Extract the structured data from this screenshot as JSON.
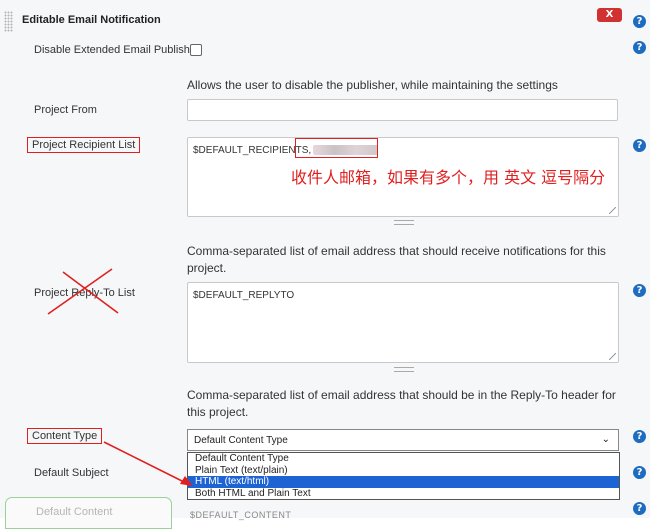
{
  "section": {
    "title": "Editable Email Notification",
    "close_label": "X"
  },
  "fields": {
    "disable_publisher": {
      "label": "Disable Extended Email Publisher",
      "checked": false,
      "description": "Allows the user to disable the publisher, while maintaining the settings"
    },
    "project_from": {
      "label": "Project From",
      "value": ""
    },
    "recipient_list": {
      "label": "Project Recipient List",
      "value": "$DEFAULT_RECIPIENTS,",
      "annotation": "收件人邮箱，如果有多个，用 英文 逗号隔分",
      "description": "Comma-separated list of email address that should receive notifications for this project."
    },
    "reply_to": {
      "label": "Project Reply-To List",
      "value": "$DEFAULT_REPLYTO",
      "description": "Comma-separated list of email address that should be in the Reply-To header for this project."
    },
    "content_type": {
      "label": "Content Type",
      "selected": "Default Content Type",
      "options": [
        "Default Content Type",
        "Plain Text (text/plain)",
        "HTML (text/html)",
        "Both HTML and Plain Text"
      ],
      "highlighted": "HTML (text/html)"
    },
    "default_subject": {
      "label": "Default Subject"
    },
    "default_content": {
      "label": "Default Content",
      "value_clipped": "$DEFAULT_CONTENT"
    }
  },
  "icons": {
    "help": "?",
    "chevron": "⌄"
  },
  "colors": {
    "accent": "#1d6cc0",
    "annotation_red": "#e02020",
    "selection": "#1e63d3",
    "close": "#d23131"
  }
}
